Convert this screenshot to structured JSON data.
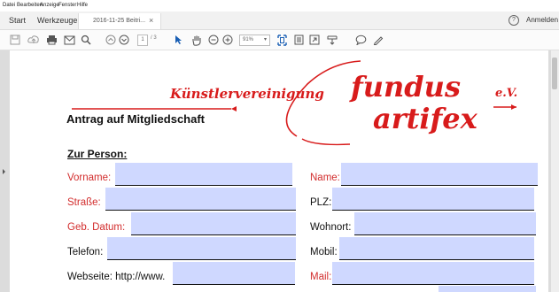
{
  "menu": {
    "items": [
      "Datei",
      "Bearbeiten",
      "Anzeige",
      "Fenster",
      "Hilfe"
    ]
  },
  "tabs": {
    "home": "Start",
    "tools": "Werkzeuge",
    "document": "2016-11-25 Beitri..."
  },
  "header": {
    "help_symbol": "?",
    "signin": "Anmelden"
  },
  "toolbar": {
    "page_number": "1",
    "page_count": "/ 3",
    "zoom": "91%"
  },
  "logo": {
    "club": "Künstlervereinigung",
    "word1": "fundus",
    "word2": "artifex",
    "suffix": "e.V."
  },
  "form": {
    "title": "Antrag auf Mitgliedschaft",
    "section": "Zur Person:",
    "fields": {
      "vorname": "Vorname:",
      "name": "Name:",
      "strasse": "Straße:",
      "plz": "PLZ:",
      "geb": "Geb. Datum:",
      "wohnort": "Wohnort:",
      "telefon": "Telefon:",
      "mobil": "Mobil:",
      "webseite": "Webseite: http://www.",
      "mail": "Mail:"
    }
  },
  "colors": {
    "accent": "#d81b1b",
    "field_fill": "#cfd8ff",
    "required_label": "#d22c2c"
  }
}
